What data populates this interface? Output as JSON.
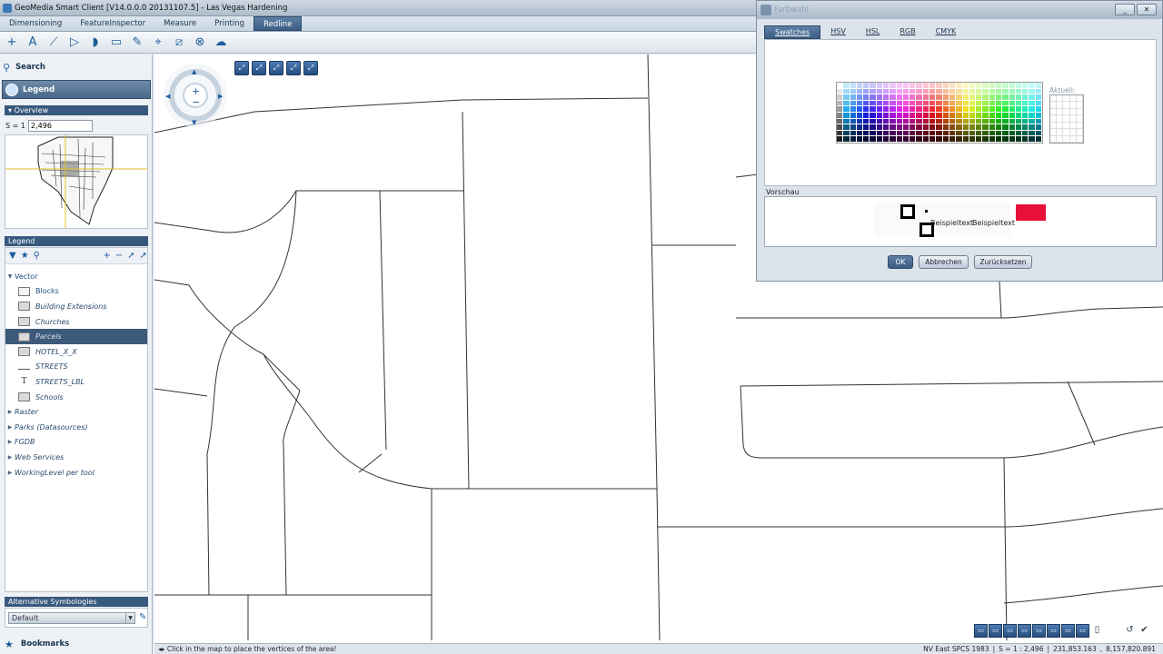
{
  "app": {
    "title": "GeoMedia Smart Client  [V14.0.0.0  20131107.5] - Las Vegas Hardening"
  },
  "tabs": [
    "Dimensioning",
    "FeatureInspector",
    "Measure",
    "Printing",
    "Redline"
  ],
  "active_tab": "Redline",
  "toolbar_icons": [
    "plus-icon",
    "text-icon",
    "polyline-icon",
    "polygon-icon",
    "shape-icon",
    "rectangle-icon",
    "pen-icon",
    "vertex-icon",
    "ruler-icon",
    "erase-icon",
    "cloud-icon"
  ],
  "left": {
    "search_label": "Search",
    "legend_accordion_label": "Legend",
    "overview": {
      "header": "Overview",
      "scale_prefix": "S = 1 :",
      "scale_value": "2,496"
    },
    "legend": {
      "header": "Legend",
      "items": [
        {
          "label": "Vector",
          "level": "top",
          "expanded": true
        },
        {
          "label": "Blocks",
          "level": "child",
          "icon": "polygon"
        },
        {
          "label": "Building Extensions",
          "level": "child",
          "icon": "poly"
        },
        {
          "label": "Churches",
          "level": "child",
          "icon": "poly"
        },
        {
          "label": "Parcels",
          "level": "child",
          "icon": "poly",
          "selected": true
        },
        {
          "label": "HOTEL_X_X",
          "level": "child",
          "icon": "poly"
        },
        {
          "label": "STREETS",
          "level": "child",
          "icon": "line"
        },
        {
          "label": "STREETS_LBL",
          "level": "child",
          "icon": "text"
        },
        {
          "label": "Schools",
          "level": "child",
          "icon": "poly"
        },
        {
          "label": "Raster",
          "level": "top"
        },
        {
          "label": "Parks (Datasources)",
          "level": "top"
        },
        {
          "label": "FGDB",
          "level": "top"
        },
        {
          "label": "Web Services",
          "level": "top"
        },
        {
          "label": "WorkingLevel per tool",
          "level": "top"
        }
      ]
    },
    "alt_symbologies": {
      "header": "Alternative Symbologies",
      "selected": "Default"
    },
    "bookmarks_label": "Bookmarks"
  },
  "status": {
    "message": "Click in the map to place the vertices of the area!",
    "crs": "NV East SPCS 1983",
    "scale": "S = 1 :  2,496",
    "x": "231,853.163",
    "y": "8,157,820.891"
  },
  "dialog": {
    "title": "Farbwahl",
    "tabs": [
      "Swatches",
      "HSV",
      "HSL",
      "RGB",
      "CMYK"
    ],
    "active_tab": "Swatches",
    "recent_label": "Aktuell:",
    "preview_label": "Vorschau",
    "sample_text_1": "Beispieltext",
    "sample_text_2": "Beispieltext",
    "selected_color": "#e8103a",
    "buttons": {
      "ok": "OK",
      "cancel": "Abbrechen",
      "reset": "Zurücksetzen"
    }
  }
}
